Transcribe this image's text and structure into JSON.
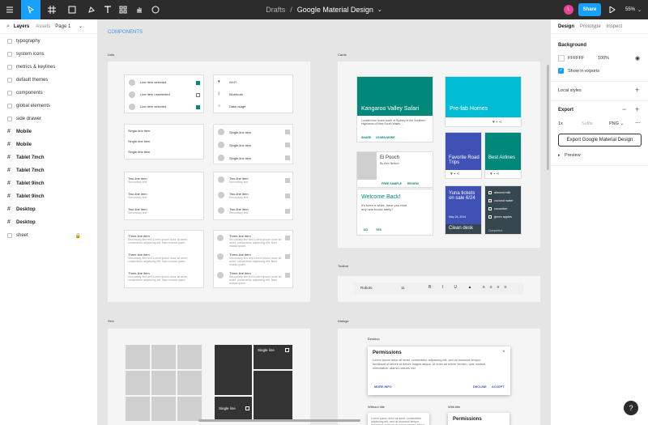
{
  "toolbar": {
    "breadcrumb_parent": "Drafts",
    "separator": "/",
    "file_name": "Google Material Design",
    "share_label": "Share",
    "avatar_initial": "L",
    "zoom": "55%"
  },
  "left_panel": {
    "tab_layers": "Layers",
    "tab_assets": "Assets",
    "page_selector": "Page 1",
    "layers": [
      {
        "label": "typography",
        "type": "component"
      },
      {
        "label": "system icons",
        "type": "component"
      },
      {
        "label": "metrics & keylines",
        "type": "component"
      },
      {
        "label": "default themes",
        "type": "component"
      },
      {
        "label": "components",
        "type": "component"
      },
      {
        "label": "global elements",
        "type": "component"
      },
      {
        "label": "side drawer",
        "type": "component"
      },
      {
        "label": "Mobile",
        "type": "frame"
      },
      {
        "label": "Mobile",
        "type": "frame"
      },
      {
        "label": "Tablet 7inch",
        "type": "frame"
      },
      {
        "label": "Tablet 7inch",
        "type": "frame"
      },
      {
        "label": "Tablet 9inch",
        "type": "frame"
      },
      {
        "label": "Tablet 9inch",
        "type": "frame"
      },
      {
        "label": "Desktop",
        "type": "frame"
      },
      {
        "label": "Desktop",
        "type": "frame"
      },
      {
        "label": "sheet",
        "type": "component",
        "locked": true
      }
    ]
  },
  "canvas": {
    "section_title": "COMPONENTS",
    "frames": {
      "lists": "Lists",
      "cards": "Cards",
      "toolbar": "Toolbar",
      "grid": "Grid",
      "dialogs": "Dialogs"
    },
    "lists": {
      "line_item_selected": "Line item selected",
      "line_item_unselected": "Line item unselected",
      "wifi": "Wi-Fi",
      "bluetooth": "Bluetooth",
      "data_usage": "Data usage",
      "single_line": "Single-line item",
      "two_line": "Two-line item",
      "secondary": "Secondary text",
      "three_line": "Three-line item",
      "three_line_text": "Secondary line text Lorem ipsum dolor sit amet, consectetur adipiscing elit. Nam massa quam."
    },
    "cards": {
      "kangaroo_title": "Kangaroo Valley Safari",
      "kangaroo_text": "Located two hours south of Sydney in the Southern Highlands of New South Wales, ...",
      "share": "SHARE",
      "learn_more": "LEARN MORE",
      "prefab": "Pre-fab Homes",
      "pooch_title": "El Pooch",
      "pooch_sub": "By Alex Nelson",
      "free_sample": "FREE SAMPLE",
      "review": "REVIEW",
      "fav_trips": "Favorite Road Trips",
      "best_airlines": "Best Airlines",
      "welcome_title": "Welcome Back!",
      "welcome_text": "It's been a while, have you read any new books lately?",
      "no": "NO",
      "yes": "YES",
      "yuna": "Yuna tickets on sale 6/24",
      "yuna_date": "May 24, 2014",
      "clean_desk": "Clean desk",
      "checklist": [
        "almond milk",
        "coconut water",
        "cucumber",
        "green apples"
      ],
      "completed": "Completed"
    },
    "toolbar_frame": {
      "font": "Roboto",
      "size": "11"
    },
    "grid": {
      "single_line": "Single line",
      "single_line2": "Single line"
    },
    "dialogs": {
      "desktop_label": "Desktop",
      "title": "Permissions",
      "body": "Lorem ipsum dolor sit amet, consectetur adipiscing elit, sed do eiusmod tempor incididunt ut labore et dolore magna aliqua. Ut enim ad minim veniam, quis nostrud exercitation ullamco laboris nisi.",
      "more_info": "MORE INFO",
      "decline": "DECLINE",
      "accept": "ACCEPT",
      "without_title": "Without title",
      "with_title": "With title",
      "title2": "Permissions"
    }
  },
  "right_panel": {
    "tab_design": "Design",
    "tab_prototype": "Prototype",
    "tab_inspect": "Inspect",
    "background_title": "Background",
    "background_hex": "FFFFFF",
    "background_opacity": "100%",
    "show_in_exports": "Show in exports",
    "local_styles": "Local styles",
    "export_title": "Export",
    "export_scale": "1x",
    "export_suffix_placeholder": "Suffix",
    "export_format": "PNG",
    "export_button": "Export Google Material Design",
    "preview": "Preview"
  },
  "colors": {
    "accent": "#18a0fb",
    "toolbar_bg": "#2c2c2c",
    "teal": "#00897b",
    "cyan": "#00bcd4",
    "indigo": "#3f51b5",
    "blue_grey": "#37474f"
  },
  "help_label": "?"
}
